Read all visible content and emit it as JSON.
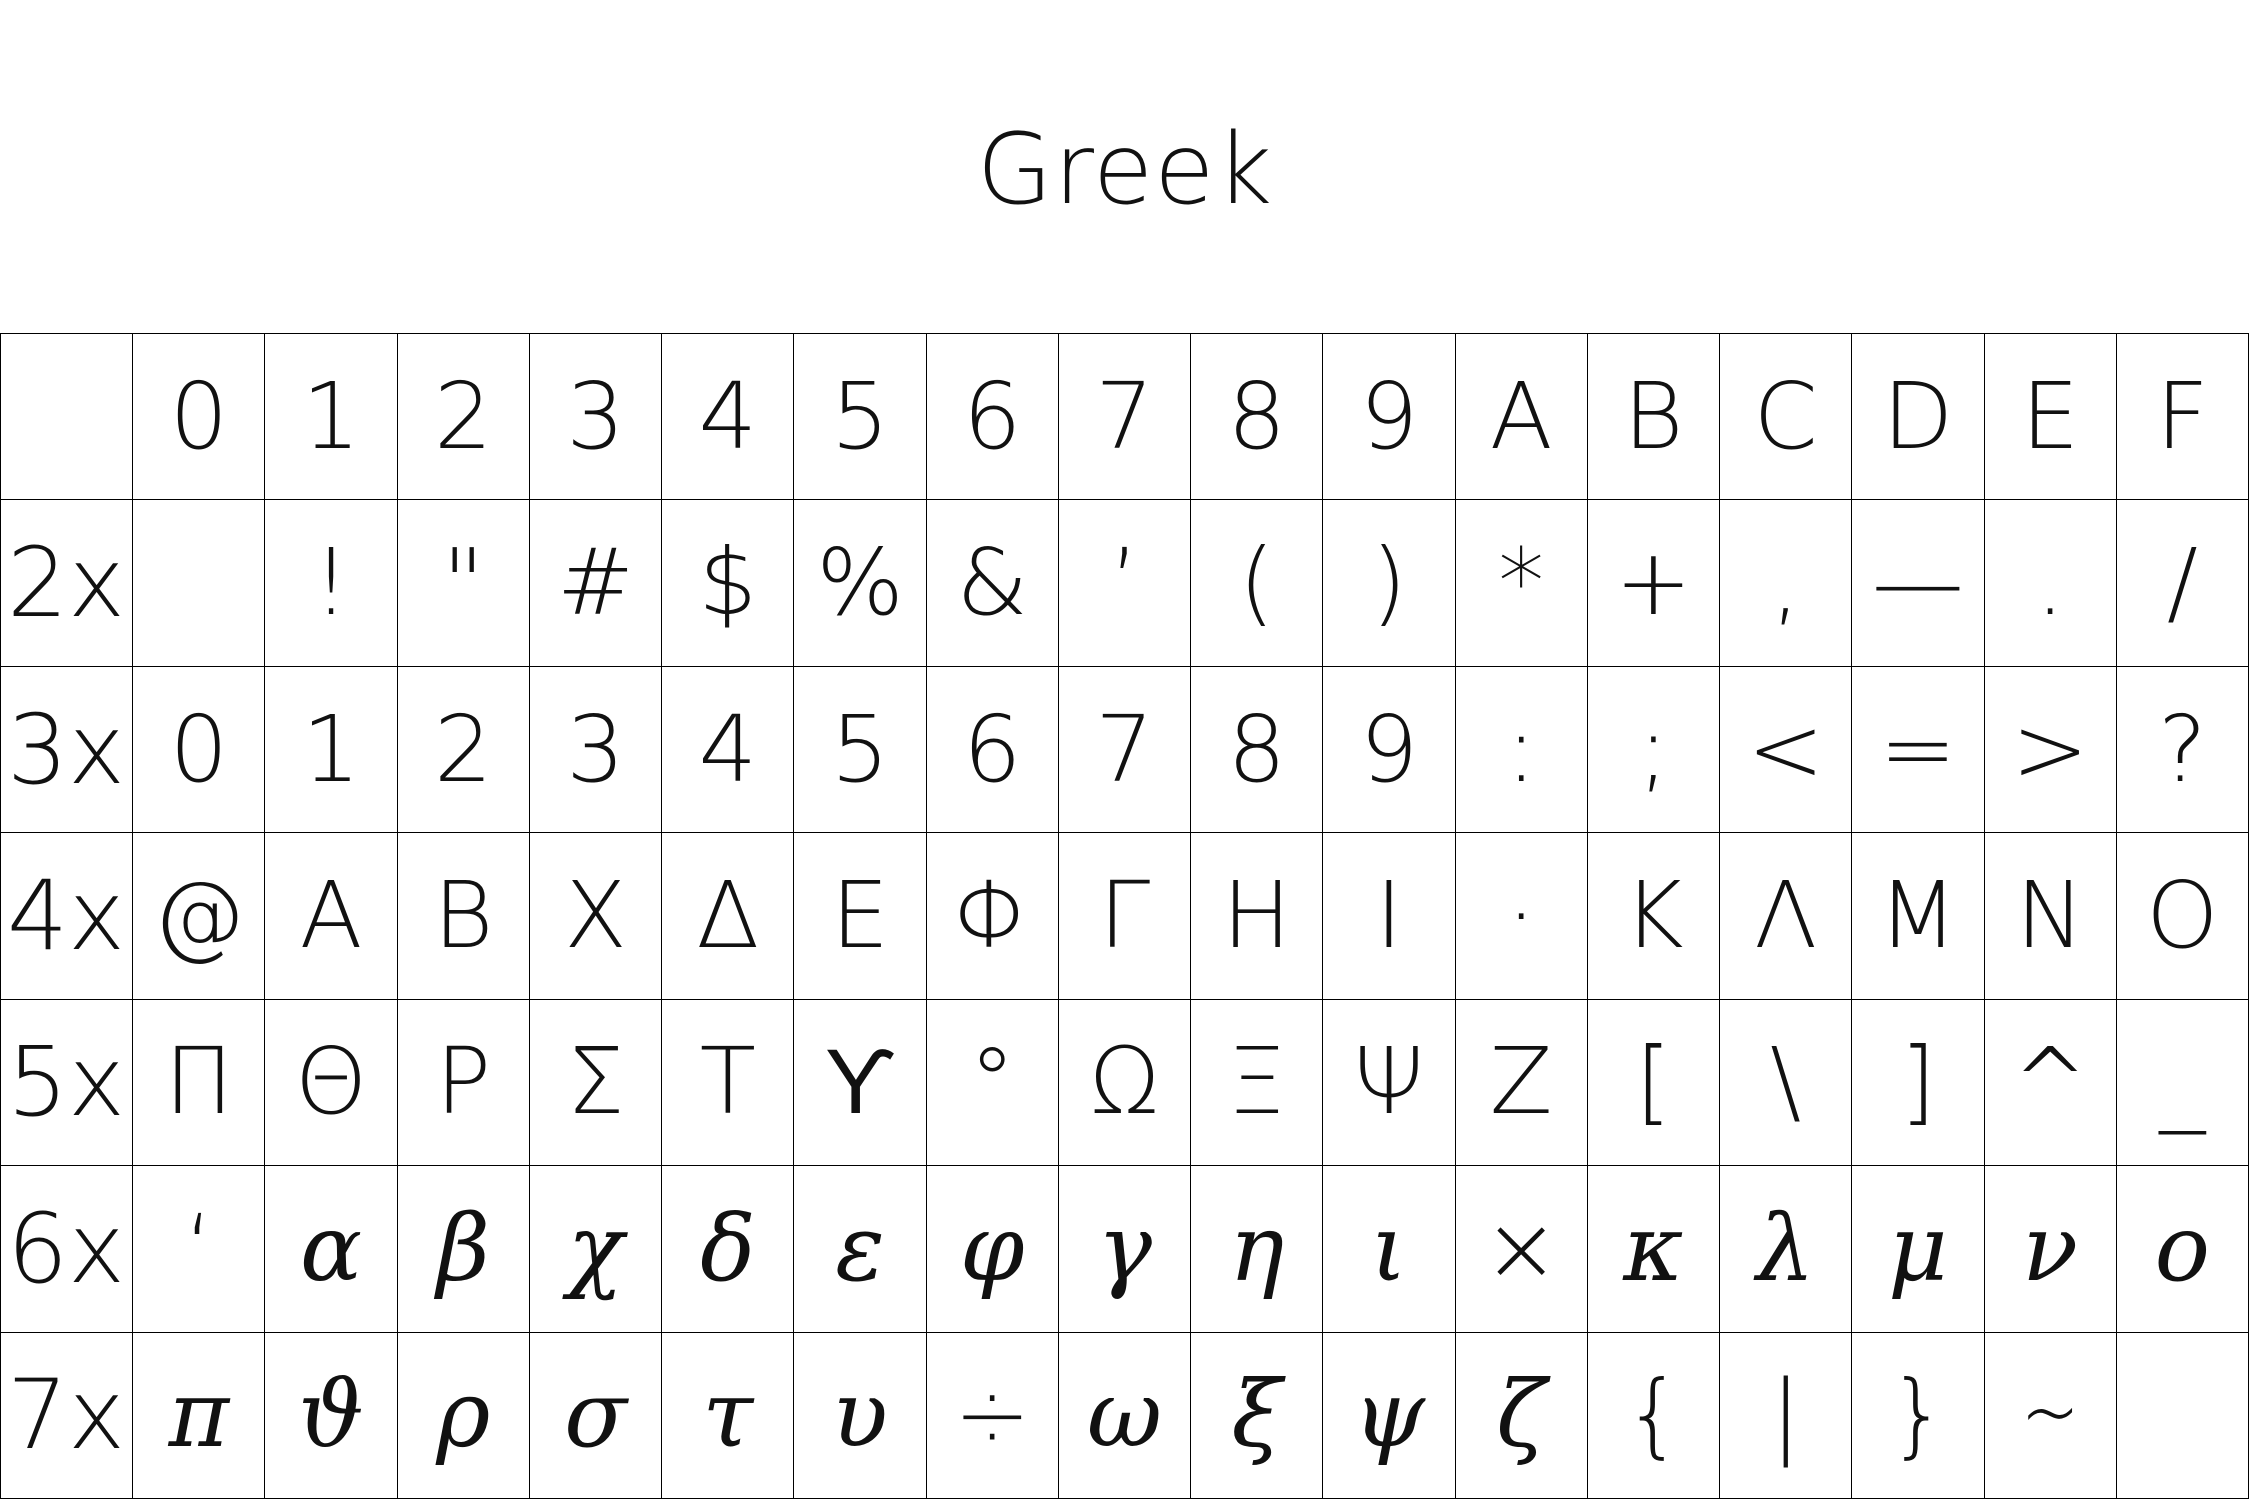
{
  "title": "Greek",
  "columns": [
    "0",
    "1",
    "2",
    "3",
    "4",
    "5",
    "6",
    "7",
    "8",
    "9",
    "A",
    "B",
    "C",
    "D",
    "E",
    "F"
  ],
  "rows": [
    {
      "label": "2x",
      "italic": false,
      "glyphs": [
        "",
        "!",
        "\"",
        "#",
        "$",
        "%",
        "&",
        "’",
        "(",
        ")",
        "*",
        "+",
        ",",
        "—",
        ".",
        "/"
      ]
    },
    {
      "label": "3x",
      "italic": false,
      "glyphs": [
        "0",
        "1",
        "2",
        "3",
        "4",
        "5",
        "6",
        "7",
        "8",
        "9",
        ":",
        ";",
        "<",
        "=",
        ">",
        "?"
      ]
    },
    {
      "label": "4x",
      "italic": false,
      "glyphs": [
        "@",
        "A",
        "B",
        "Χ",
        "Δ",
        "Ε",
        "Φ",
        "Γ",
        "Η",
        "Ι",
        "·",
        "Κ",
        "Λ",
        "Μ",
        "Ν",
        "Ο"
      ]
    },
    {
      "label": "5x",
      "italic": false,
      "glyphs": [
        "Π",
        "Θ",
        "Ρ",
        "Σ",
        "Τ",
        "ϒ",
        "°",
        "Ω",
        "Ξ",
        "Ψ",
        "Ζ",
        "[",
        "\\",
        "]",
        "^",
        "_"
      ]
    },
    {
      "label": "6x",
      "italic": true,
      "glyphs": [
        "‘",
        "α",
        "β",
        "χ",
        "δ",
        "ε",
        "φ",
        "γ",
        "η",
        "ι",
        "×",
        "κ",
        "λ",
        "μ",
        "ν",
        "ο"
      ]
    },
    {
      "label": "7x",
      "italic": true,
      "glyphs": [
        "π",
        "ϑ",
        "ρ",
        "σ",
        "τ",
        "υ",
        "÷",
        "ω",
        "ξ",
        "ψ",
        "ζ",
        "{",
        "|",
        "}",
        "∼",
        ""
      ]
    }
  ]
}
